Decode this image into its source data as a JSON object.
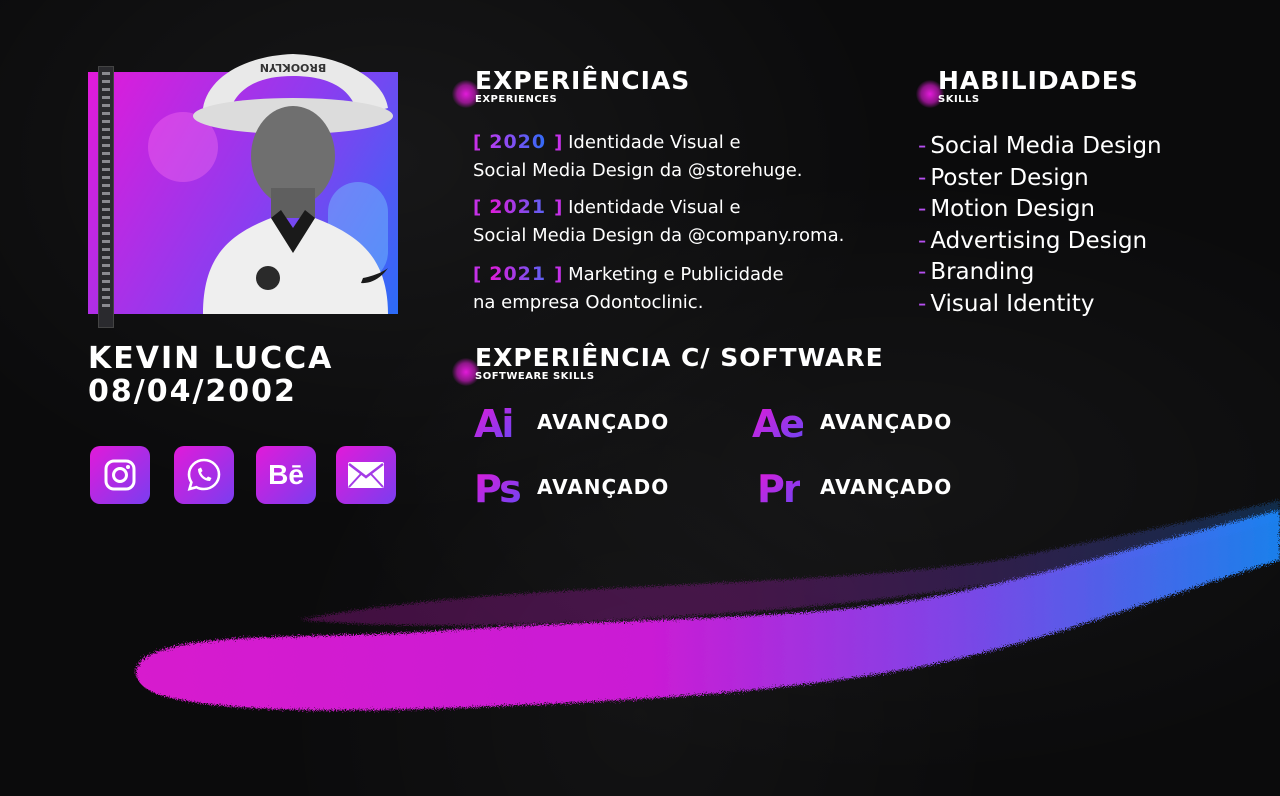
{
  "profile": {
    "name": "KEVIN LUCCA",
    "birthdate": "08/04/2002",
    "hat_text": "BROOKLYN"
  },
  "social": [
    {
      "name": "instagram",
      "icon": "instagram-icon"
    },
    {
      "name": "whatsapp",
      "icon": "whatsapp-icon"
    },
    {
      "name": "behance",
      "icon": "behance-icon",
      "glyph": "Bē"
    },
    {
      "name": "email",
      "icon": "mail-icon"
    }
  ],
  "experiences": {
    "title": "EXPERIÊNCIAS",
    "subtitle": "EXPERIENCES",
    "items": [
      {
        "bracket_open": "[",
        "year": "2020",
        "bracket_close": "]",
        "line1": "Identidade Visual e",
        "line2": "Social Media Design da @storehuge."
      },
      {
        "bracket_open": "[",
        "year": "2021",
        "bracket_close": "]",
        "line1": "Identidade Visual e",
        "line2": "Social Media Design da @company.roma."
      },
      {
        "bracket_open": "[",
        "year": "2021",
        "bracket_close": "]",
        "line1": "Marketing e Publicidade",
        "line2": "na empresa Odontoclinic."
      }
    ]
  },
  "skills": {
    "title": "HABILIDADES",
    "subtitle": "SKILLS",
    "dash": "-",
    "items": [
      "Social Media Design",
      "Poster Design",
      "Motion Design",
      "Advertising Design",
      "Branding",
      "Visual Identity"
    ]
  },
  "software": {
    "title": "EXPERIÊNCIA C/ SOFTWARE",
    "subtitle": "SOFTWEARE SKILLS",
    "items": [
      {
        "abbr": "Ai",
        "level": "AVANÇADO"
      },
      {
        "abbr": "Ae",
        "level": "AVANÇADO"
      },
      {
        "abbr": "Ps",
        "level": "AVANÇADO"
      },
      {
        "abbr": "Pr",
        "level": "AVANÇADO"
      }
    ]
  },
  "colors": {
    "magenta": "#e21ad9",
    "purple": "#8b3df0",
    "blue": "#2b6cf7",
    "background": "#0b0b0c"
  }
}
